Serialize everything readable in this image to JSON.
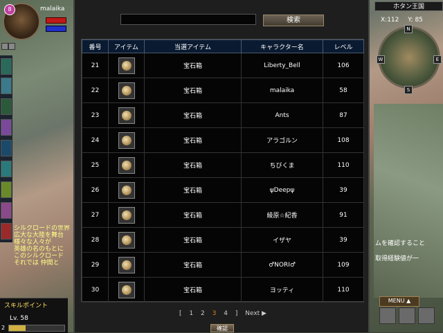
{
  "player": {
    "name": "malaika",
    "badge": "8"
  },
  "hud": {
    "skill_point_label": "スキルポイント",
    "level": "Lv. 58",
    "level_number": "2",
    "chat_lines": [
      "シルクロードの世界",
      "広大な大陸を舞台",
      "様々な人々が",
      "英雄の名のもとに",
      "このシルクロード",
      "それでは 仲間と"
    ]
  },
  "region": {
    "title": "ホタン王国",
    "x": "X:112",
    "y": "Y: 85"
  },
  "right_chat": [
    "ムを確認すること",
    "取得経験値が一"
  ],
  "menu": {
    "label": "MENU ▲"
  },
  "search": {
    "button_label": "検索",
    "value": ""
  },
  "table": {
    "headers": [
      "番号",
      "アイテム",
      "当選アイテム",
      "キャラクター名",
      "レベル"
    ],
    "rows": [
      {
        "no": "21",
        "item_icon": "jewel-box-icon",
        "prize": "宝石箱",
        "character": "Liberty_Bell",
        "level": "106"
      },
      {
        "no": "22",
        "item_icon": "jewel-box-icon",
        "prize": "宝石箱",
        "character": "malaika",
        "level": "58"
      },
      {
        "no": "23",
        "item_icon": "jewel-box-icon",
        "prize": "宝石箱",
        "character": "Ants",
        "level": "87"
      },
      {
        "no": "24",
        "item_icon": "jewel-box-icon",
        "prize": "宝石箱",
        "character": "アラゴルン",
        "level": "108"
      },
      {
        "no": "25",
        "item_icon": "jewel-box-icon",
        "prize": "宝石箱",
        "character": "ちびくま",
        "level": "110"
      },
      {
        "no": "26",
        "item_icon": "jewel-box-icon",
        "prize": "宝石箱",
        "character": "ψDeepψ",
        "level": "39"
      },
      {
        "no": "27",
        "item_icon": "jewel-box-icon",
        "prize": "宝石箱",
        "character": "綾原☆紀香",
        "level": "91"
      },
      {
        "no": "28",
        "item_icon": "jewel-box-icon",
        "prize": "宝石箱",
        "character": "イザヤ",
        "level": "39"
      },
      {
        "no": "29",
        "item_icon": "jewel-box-icon",
        "prize": "宝石箱",
        "character": "♂NORI♂",
        "level": "109"
      },
      {
        "no": "30",
        "item_icon": "jewel-box-icon",
        "prize": "宝石箱",
        "character": "ヨッティ",
        "level": "110"
      }
    ]
  },
  "pager": {
    "open": "[",
    "pages": [
      "1",
      "2",
      "3",
      "4"
    ],
    "current": "3",
    "close": "]",
    "next": "Next ▶"
  },
  "confirm_label": "確認",
  "colors": {
    "header_bg": "#0a1a30",
    "current_page": "#e08020",
    "search_button": "#6c6354"
  }
}
